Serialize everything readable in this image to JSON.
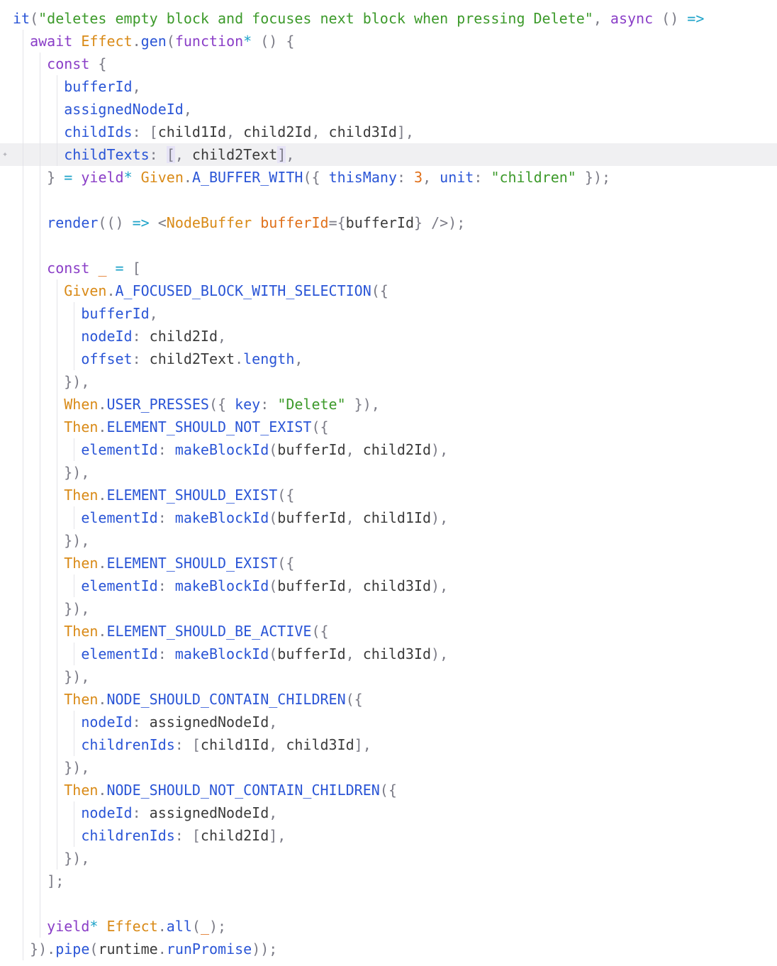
{
  "editor": {
    "language": "typescript",
    "highlighted_line_index": 6,
    "lines": [
      {
        "indent": 0,
        "tokens": [
          [
            "fn",
            "it"
          ],
          [
            "pun",
            "("
          ],
          [
            "str",
            "\"deletes empty block and focuses next block when pressing Delete\""
          ],
          [
            "pun",
            ", "
          ],
          [
            "kw",
            "async"
          ],
          [
            "pun",
            " () "
          ],
          [
            "op",
            "=>"
          ]
        ]
      },
      {
        "indent": 1,
        "tokens": [
          [
            "kw",
            "await"
          ],
          [
            "plain",
            " "
          ],
          [
            "obj",
            "Effect"
          ],
          [
            "pun",
            "."
          ],
          [
            "fn",
            "gen"
          ],
          [
            "pun",
            "("
          ],
          [
            "kw",
            "function"
          ],
          [
            "op",
            "*"
          ],
          [
            "pun",
            " () {"
          ]
        ]
      },
      {
        "indent": 2,
        "tokens": [
          [
            "kw",
            "const"
          ],
          [
            "pun",
            " {"
          ]
        ]
      },
      {
        "indent": 3,
        "tokens": [
          [
            "fn",
            "bufferId"
          ],
          [
            "pun",
            ","
          ]
        ]
      },
      {
        "indent": 3,
        "tokens": [
          [
            "fn",
            "assignedNodeId"
          ],
          [
            "pun",
            ","
          ]
        ]
      },
      {
        "indent": 3,
        "tokens": [
          [
            "fn",
            "childIds"
          ],
          [
            "pun",
            ": ["
          ],
          [
            "plain",
            "child1Id"
          ],
          [
            "pun",
            ", "
          ],
          [
            "plain",
            "child2Id"
          ],
          [
            "pun",
            ", "
          ],
          [
            "plain",
            "child3Id"
          ],
          [
            "pun",
            "],"
          ]
        ]
      },
      {
        "indent": 3,
        "tokens": [
          [
            "fn",
            "childTexts"
          ],
          [
            "pun",
            ": "
          ],
          [
            "pun",
            "[",
            true
          ],
          [
            "pun",
            ", "
          ],
          [
            "plain",
            "child2Text"
          ],
          [
            "pun",
            "]",
            true
          ],
          [
            "pun",
            ","
          ]
        ]
      },
      {
        "indent": 2,
        "tokens": [
          [
            "pun",
            "} "
          ],
          [
            "op",
            "="
          ],
          [
            "plain",
            " "
          ],
          [
            "kw",
            "yield"
          ],
          [
            "op",
            "*"
          ],
          [
            "plain",
            " "
          ],
          [
            "obj",
            "Given"
          ],
          [
            "pun",
            "."
          ],
          [
            "fn",
            "A_BUFFER_WITH"
          ],
          [
            "pun",
            "({ "
          ],
          [
            "fn",
            "thisMany"
          ],
          [
            "pun",
            ": "
          ],
          [
            "num",
            "3"
          ],
          [
            "pun",
            ", "
          ],
          [
            "fn",
            "unit"
          ],
          [
            "pun",
            ": "
          ],
          [
            "str",
            "\"children\""
          ],
          [
            "pun",
            " });"
          ]
        ]
      },
      {
        "indent": 2,
        "tokens": []
      },
      {
        "indent": 2,
        "tokens": [
          [
            "fn",
            "render"
          ],
          [
            "pun",
            "(() "
          ],
          [
            "op",
            "=>"
          ],
          [
            "plain",
            " "
          ],
          [
            "pun",
            "<"
          ],
          [
            "obj",
            "NodeBuffer"
          ],
          [
            "plain",
            " "
          ],
          [
            "num",
            "bufferId"
          ],
          [
            "pun",
            "={"
          ],
          [
            "plain",
            "bufferId"
          ],
          [
            "pun",
            "} />);"
          ]
        ]
      },
      {
        "indent": 2,
        "tokens": []
      },
      {
        "indent": 2,
        "tokens": [
          [
            "kw",
            "const"
          ],
          [
            "plain",
            " "
          ],
          [
            "num",
            "_"
          ],
          [
            "plain",
            " "
          ],
          [
            "op",
            "="
          ],
          [
            "pun",
            " ["
          ]
        ]
      },
      {
        "indent": 3,
        "tokens": [
          [
            "obj",
            "Given"
          ],
          [
            "pun",
            "."
          ],
          [
            "fn",
            "A_FOCUSED_BLOCK_WITH_SELECTION"
          ],
          [
            "pun",
            "({"
          ]
        ]
      },
      {
        "indent": 4,
        "tokens": [
          [
            "fn",
            "bufferId"
          ],
          [
            "pun",
            ","
          ]
        ]
      },
      {
        "indent": 4,
        "tokens": [
          [
            "fn",
            "nodeId"
          ],
          [
            "pun",
            ": "
          ],
          [
            "plain",
            "child2Id"
          ],
          [
            "pun",
            ","
          ]
        ]
      },
      {
        "indent": 4,
        "tokens": [
          [
            "fn",
            "offset"
          ],
          [
            "pun",
            ": "
          ],
          [
            "plain",
            "child2Text"
          ],
          [
            "pun",
            "."
          ],
          [
            "fn",
            "length"
          ],
          [
            "pun",
            ","
          ]
        ]
      },
      {
        "indent": 3,
        "tokens": [
          [
            "pun",
            "}),"
          ]
        ]
      },
      {
        "indent": 3,
        "tokens": [
          [
            "obj",
            "When"
          ],
          [
            "pun",
            "."
          ],
          [
            "fn",
            "USER_PRESSES"
          ],
          [
            "pun",
            "({ "
          ],
          [
            "fn",
            "key"
          ],
          [
            "pun",
            ": "
          ],
          [
            "str",
            "\"Delete\""
          ],
          [
            "pun",
            " }),"
          ]
        ]
      },
      {
        "indent": 3,
        "tokens": [
          [
            "obj",
            "Then"
          ],
          [
            "pun",
            "."
          ],
          [
            "fn",
            "ELEMENT_SHOULD_NOT_EXIST"
          ],
          [
            "pun",
            "({"
          ]
        ]
      },
      {
        "indent": 4,
        "tokens": [
          [
            "fn",
            "elementId"
          ],
          [
            "pun",
            ": "
          ],
          [
            "fn",
            "makeBlockId"
          ],
          [
            "pun",
            "("
          ],
          [
            "plain",
            "bufferId"
          ],
          [
            "pun",
            ", "
          ],
          [
            "plain",
            "child2Id"
          ],
          [
            "pun",
            "),"
          ]
        ]
      },
      {
        "indent": 3,
        "tokens": [
          [
            "pun",
            "}),"
          ]
        ]
      },
      {
        "indent": 3,
        "tokens": [
          [
            "obj",
            "Then"
          ],
          [
            "pun",
            "."
          ],
          [
            "fn",
            "ELEMENT_SHOULD_EXIST"
          ],
          [
            "pun",
            "({"
          ]
        ]
      },
      {
        "indent": 4,
        "tokens": [
          [
            "fn",
            "elementId"
          ],
          [
            "pun",
            ": "
          ],
          [
            "fn",
            "makeBlockId"
          ],
          [
            "pun",
            "("
          ],
          [
            "plain",
            "bufferId"
          ],
          [
            "pun",
            ", "
          ],
          [
            "plain",
            "child1Id"
          ],
          [
            "pun",
            "),"
          ]
        ]
      },
      {
        "indent": 3,
        "tokens": [
          [
            "pun",
            "}),"
          ]
        ]
      },
      {
        "indent": 3,
        "tokens": [
          [
            "obj",
            "Then"
          ],
          [
            "pun",
            "."
          ],
          [
            "fn",
            "ELEMENT_SHOULD_EXIST"
          ],
          [
            "pun",
            "({"
          ]
        ]
      },
      {
        "indent": 4,
        "tokens": [
          [
            "fn",
            "elementId"
          ],
          [
            "pun",
            ": "
          ],
          [
            "fn",
            "makeBlockId"
          ],
          [
            "pun",
            "("
          ],
          [
            "plain",
            "bufferId"
          ],
          [
            "pun",
            ", "
          ],
          [
            "plain",
            "child3Id"
          ],
          [
            "pun",
            "),"
          ]
        ]
      },
      {
        "indent": 3,
        "tokens": [
          [
            "pun",
            "}),"
          ]
        ]
      },
      {
        "indent": 3,
        "tokens": [
          [
            "obj",
            "Then"
          ],
          [
            "pun",
            "."
          ],
          [
            "fn",
            "ELEMENT_SHOULD_BE_ACTIVE"
          ],
          [
            "pun",
            "({"
          ]
        ]
      },
      {
        "indent": 4,
        "tokens": [
          [
            "fn",
            "elementId"
          ],
          [
            "pun",
            ": "
          ],
          [
            "fn",
            "makeBlockId"
          ],
          [
            "pun",
            "("
          ],
          [
            "plain",
            "bufferId"
          ],
          [
            "pun",
            ", "
          ],
          [
            "plain",
            "child3Id"
          ],
          [
            "pun",
            "),"
          ]
        ]
      },
      {
        "indent": 3,
        "tokens": [
          [
            "pun",
            "}),"
          ]
        ]
      },
      {
        "indent": 3,
        "tokens": [
          [
            "obj",
            "Then"
          ],
          [
            "pun",
            "."
          ],
          [
            "fn",
            "NODE_SHOULD_CONTAIN_CHILDREN"
          ],
          [
            "pun",
            "({"
          ]
        ]
      },
      {
        "indent": 4,
        "tokens": [
          [
            "fn",
            "nodeId"
          ],
          [
            "pun",
            ": "
          ],
          [
            "plain",
            "assignedNodeId"
          ],
          [
            "pun",
            ","
          ]
        ]
      },
      {
        "indent": 4,
        "tokens": [
          [
            "fn",
            "childrenIds"
          ],
          [
            "pun",
            ": ["
          ],
          [
            "plain",
            "child1Id"
          ],
          [
            "pun",
            ", "
          ],
          [
            "plain",
            "child3Id"
          ],
          [
            "pun",
            "],"
          ]
        ]
      },
      {
        "indent": 3,
        "tokens": [
          [
            "pun",
            "}),"
          ]
        ]
      },
      {
        "indent": 3,
        "tokens": [
          [
            "obj",
            "Then"
          ],
          [
            "pun",
            "."
          ],
          [
            "fn",
            "NODE_SHOULD_NOT_CONTAIN_CHILDREN"
          ],
          [
            "pun",
            "({"
          ]
        ]
      },
      {
        "indent": 4,
        "tokens": [
          [
            "fn",
            "nodeId"
          ],
          [
            "pun",
            ": "
          ],
          [
            "plain",
            "assignedNodeId"
          ],
          [
            "pun",
            ","
          ]
        ]
      },
      {
        "indent": 4,
        "tokens": [
          [
            "fn",
            "childrenIds"
          ],
          [
            "pun",
            ": ["
          ],
          [
            "plain",
            "child2Id"
          ],
          [
            "pun",
            "],"
          ]
        ]
      },
      {
        "indent": 3,
        "tokens": [
          [
            "pun",
            "}),"
          ]
        ]
      },
      {
        "indent": 2,
        "tokens": [
          [
            "pun",
            "];"
          ]
        ]
      },
      {
        "indent": 2,
        "tokens": []
      },
      {
        "indent": 2,
        "tokens": [
          [
            "kw",
            "yield"
          ],
          [
            "op",
            "*"
          ],
          [
            "plain",
            " "
          ],
          [
            "obj",
            "Effect"
          ],
          [
            "pun",
            "."
          ],
          [
            "fn",
            "all"
          ],
          [
            "pun",
            "("
          ],
          [
            "num",
            "_"
          ],
          [
            "pun",
            ");"
          ]
        ]
      },
      {
        "indent": 1,
        "tokens": [
          [
            "pun",
            "})."
          ],
          [
            "fn",
            "pipe"
          ],
          [
            "pun",
            "("
          ],
          [
            "plain",
            "runtime"
          ],
          [
            "pun",
            "."
          ],
          [
            "fn",
            "runPromise"
          ],
          [
            "pun",
            "));"
          ]
        ]
      }
    ]
  }
}
